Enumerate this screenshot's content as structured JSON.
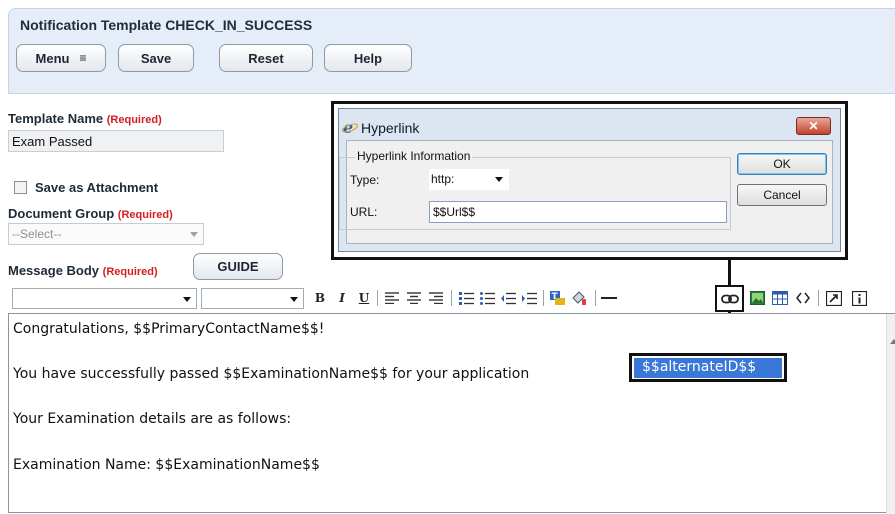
{
  "header": {
    "title": "Notification Template CHECK_IN_SUCCESS",
    "buttons": {
      "menu": "Menu",
      "menu_glyph": "≡",
      "save": "Save",
      "reset": "Reset",
      "help": "Help"
    }
  },
  "form": {
    "required": "(Required)",
    "template_name_label": "Template Name",
    "template_name_value": "Exam Passed",
    "save_as_attachment_label": "Save as Attachment",
    "document_group_label": "Document Group",
    "document_group_value": "--Select--",
    "message_body_label": "Message Body",
    "guide_button": "GUIDE"
  },
  "toolbar": {
    "bold": "B",
    "italic": "I",
    "underline": "U"
  },
  "editor": {
    "lines": [
      "Congratulations, $$PrimaryContactName$$!",
      "You have successfully passed $$ExaminationName$$ for your application",
      "Your Examination details are as follows:",
      "Examination Name: $$ExaminationName$$"
    ],
    "selected_token": "$$alternateID$$"
  },
  "dialog": {
    "title": "Hyperlink",
    "close_glyph": "✕",
    "group_label": "Hyperlink Information",
    "type_label": "Type:",
    "type_value": "http:",
    "url_label": "URL:",
    "url_value": "$$Url$$",
    "ok": "OK",
    "cancel": "Cancel"
  },
  "colors": {
    "accent": "#3a78d8",
    "required": "#d21f1f",
    "header_bg": "#e4edf8"
  }
}
